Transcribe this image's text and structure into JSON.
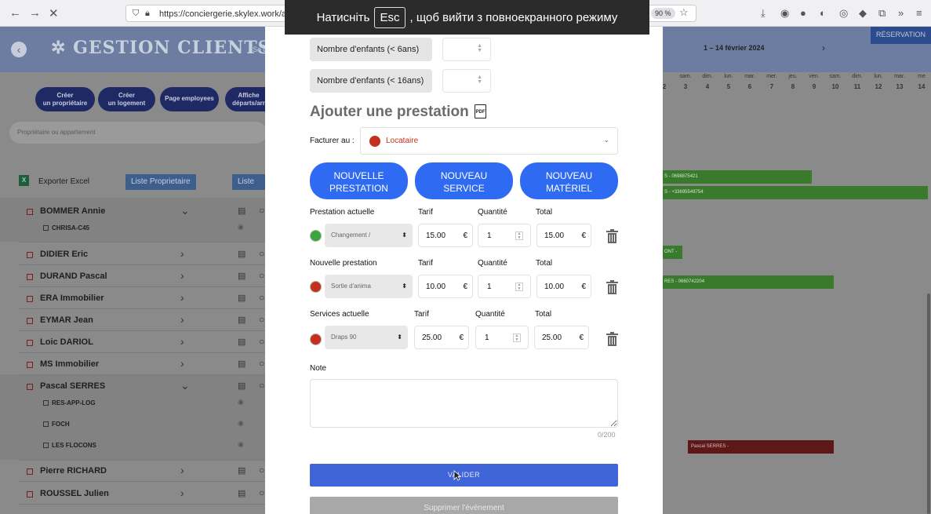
{
  "browser": {
    "url": "https://conciergerie.skylex.work/administrat",
    "zoom": "90 %",
    "fullscreen_notice": {
      "before": "Натисніть",
      "key": "Esc",
      "after": ", щоб вийти з повноекранного режиму"
    }
  },
  "app": {
    "title": "GESTION CLIENTS",
    "subtitle": "Se d",
    "reservation_label": "RÉSERVATION",
    "date_range": "1 – 14 février 2024",
    "buttons": [
      {
        "line1": "Créer",
        "line2": "un propriétaire"
      },
      {
        "line1": "Créer",
        "line2": "un logement"
      },
      {
        "line1": "Page employees",
        "line2": ""
      },
      {
        "line1": "Affiche",
        "line2": "départs/arr"
      }
    ],
    "search_placeholder": "Propriétaire ou appartement",
    "export_label": "Exporter Excel",
    "export_icon_letter": "X",
    "list_owner_label": "Liste Proprietaire",
    "list_apt_label": "Liste Ap",
    "clients": [
      {
        "name": "BOMMER Annie",
        "expanded": true
      },
      {
        "name": "DIDIER Eric",
        "expanded": false
      },
      {
        "name": "DURAND Pascal",
        "expanded": false
      },
      {
        "name": "ERA Immobilier",
        "expanded": false
      },
      {
        "name": "EYMAR Jean",
        "expanded": false
      },
      {
        "name": "Loic DARIOL",
        "expanded": false
      },
      {
        "name": "MS Immobilier",
        "expanded": false
      },
      {
        "name": "Pascal SERRES",
        "expanded": true
      },
      {
        "name": "Pierre RICHARD",
        "expanded": false
      },
      {
        "name": "ROUSSEL Julien",
        "expanded": false
      }
    ],
    "sub_items": [
      "CHRISA-C45",
      "RES-APP-LOG",
      "FOCH",
      "LES FLOCONS"
    ],
    "calendar_day_names": [
      "",
      "sam.",
      "dim.",
      "lun.",
      "mar.",
      "mer.",
      "jeu.",
      "ven.",
      "sam.",
      "dim.",
      "lun.",
      "mar.",
      "me"
    ],
    "calendar_day_numbers": [
      "2",
      "3",
      "4",
      "5",
      "6",
      "7",
      "8",
      "9",
      "10",
      "11",
      "12",
      "13",
      "14"
    ],
    "calendar_bars": [
      {
        "label": "S - 0698875421",
        "color": "#3a7a2d"
      },
      {
        "label": "S - +33695549754",
        "color": "#3a7a2d"
      },
      {
        "label": "ONT -",
        "color": "#3a7a2d"
      },
      {
        "label": "RES - 0660742204",
        "color": "#3a7a2d"
      },
      {
        "label": "Pascal SERRES -",
        "color": "#5e1818"
      }
    ]
  },
  "modal": {
    "children_under_6_label": "Nombre d'enfants (< 6ans)",
    "children_under_16_label": "Nombre d'enfants (< 16ans)",
    "section_title": "Ajouter une prestation",
    "pdf_icon_text": "PDF",
    "facturer_label": "Facturer au :",
    "facturer_value": "Locataire",
    "facturer_color": "#c4301c",
    "buttons": {
      "new_prestation": {
        "line1": "NOUVELLE",
        "line2": "PRESTATION"
      },
      "new_service": {
        "line1": "NOUVEAU",
        "line2": "SERVICE"
      },
      "new_materiel": {
        "line1": "NOUVEAU",
        "line2": "MATÉRIEL"
      }
    },
    "rows": [
      {
        "section": "Prestation actuelle",
        "tarif_label": "Tarif",
        "qty_label": "Quantité",
        "total_label": "Total",
        "select": "Changement /",
        "status_color": "#3aa53a",
        "tarif": "15.00",
        "qty": "1",
        "total": "15.00",
        "currency": "€"
      },
      {
        "section": "Nouvelle prestation",
        "tarif_label": "Tarif",
        "qty_label": "Quantité",
        "total_label": "Total",
        "select": "Sortie d'anima",
        "status_color": "#c4301c",
        "tarif": "10.00",
        "qty": "1",
        "total": "10.00",
        "currency": "€"
      },
      {
        "section": "Services actuelle",
        "tarif_label": "Tarif",
        "qty_label": "Quantité",
        "total_label": "Total",
        "select": "Draps 90",
        "status_color": "#c4301c",
        "tarif": "25.00",
        "qty": "1",
        "total": "25.00",
        "currency": "€"
      }
    ],
    "note_label": "Note",
    "note_value": "",
    "note_counter": "0/200",
    "validate_label": "VALIDER",
    "delete_label": "Supprimer l'évènement"
  }
}
